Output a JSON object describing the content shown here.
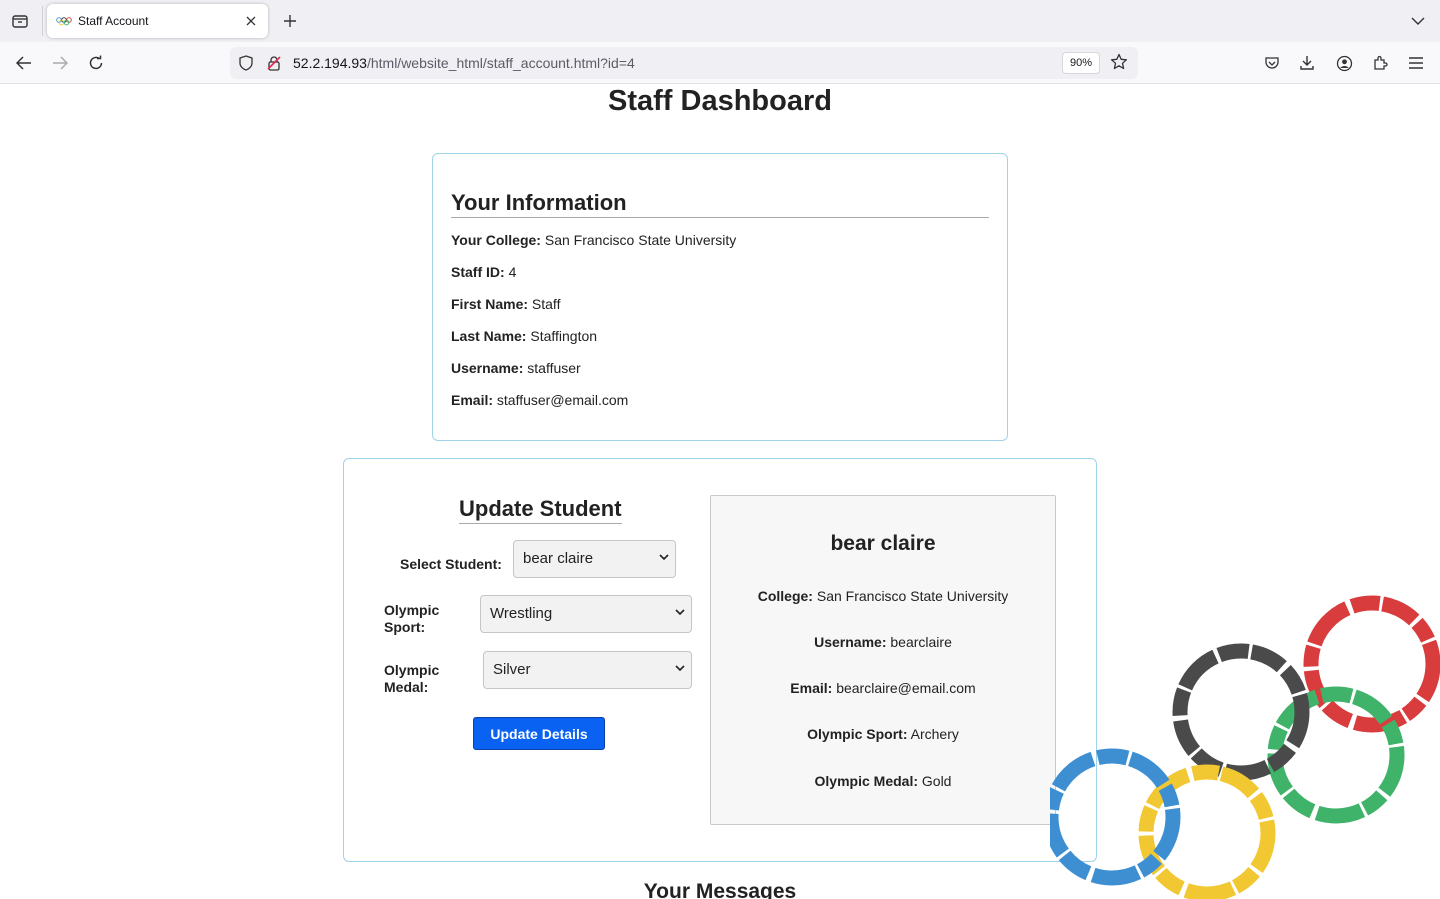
{
  "browser": {
    "tab_title": "Staff Account",
    "url_host": "52.2.194.93",
    "url_path": "/html/website_html/staff_account.html?id=4",
    "zoom": "90%"
  },
  "page": {
    "title": "Staff Dashboard"
  },
  "info": {
    "heading": "Your Information",
    "college_label": "Your College:",
    "college": "San Francisco State University",
    "staff_id_label": "Staff ID:",
    "staff_id": "4",
    "first_name_label": "First Name:",
    "first_name": "Staff",
    "last_name_label": "Last Name:",
    "last_name": "Staffington",
    "username_label": "Username:",
    "username": "staffuser",
    "email_label": "Email:",
    "email": "staffuser@email.com"
  },
  "update": {
    "heading": "Update Student",
    "select_student_label": "Select Student:",
    "select_student_value": "bear claire",
    "sport_label_1": "Olympic",
    "sport_label_2": "Sport:",
    "sport_value": "Wrestling",
    "medal_label_1": "Olympic",
    "medal_label_2": "Medal:",
    "medal_value": "Silver",
    "button_label": "Update Details"
  },
  "student": {
    "name": "bear claire",
    "college_label": "College:",
    "college": "San Francisco State University",
    "username_label": "Username:",
    "username": "bearclaire",
    "email_label": "Email:",
    "email": "bearclaire@email.com",
    "sport_label": "Olympic Sport:",
    "sport": "Archery",
    "medal_label": "Olympic Medal:",
    "medal": "Gold"
  },
  "messages": {
    "heading": "Your Messages"
  },
  "colors": {
    "accent_button": "#0a62f2",
    "card_border": "#9ed3e8",
    "ring_blue": "#3d8fd1",
    "ring_yellow": "#f2c832",
    "ring_black": "#4a4a4a",
    "ring_green": "#3fb36a",
    "ring_red": "#d93c3c"
  }
}
